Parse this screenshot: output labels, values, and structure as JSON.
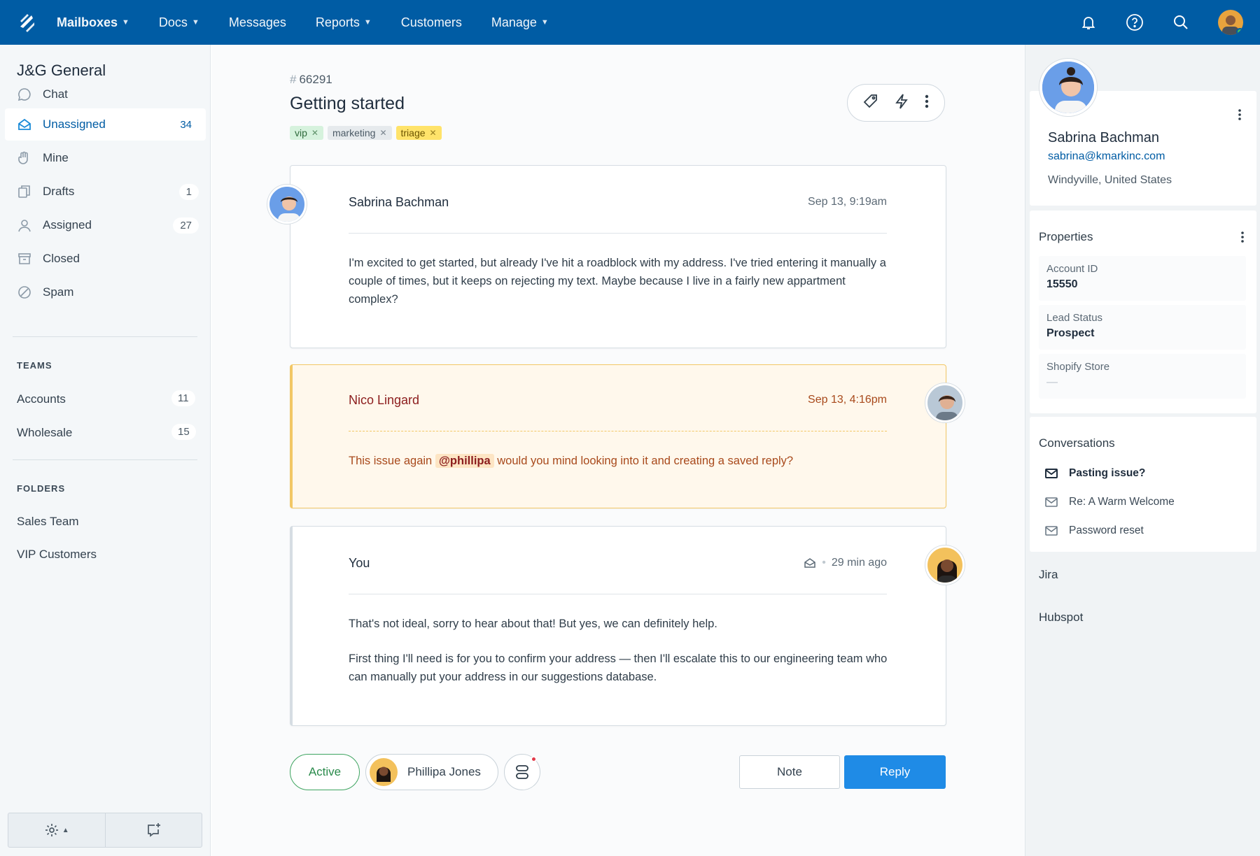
{
  "topnav": {
    "items": [
      {
        "label": "Mailboxes",
        "dropdown": true
      },
      {
        "label": "Docs",
        "dropdown": true
      },
      {
        "label": "Messages",
        "dropdown": false
      },
      {
        "label": "Reports",
        "dropdown": true
      },
      {
        "label": "Customers",
        "dropdown": false
      },
      {
        "label": "Manage",
        "dropdown": true
      }
    ],
    "icons": [
      "bell-icon",
      "help-icon",
      "search-icon",
      "user-avatar"
    ],
    "colors": {
      "bar": "#005ca4"
    }
  },
  "sidebar": {
    "title": "J&G General",
    "items": [
      {
        "label": "Chat",
        "count": "",
        "icon": "chat-icon"
      },
      {
        "label": "Unassigned",
        "count": "34",
        "icon": "inbox-icon",
        "active": true
      },
      {
        "label": "Mine",
        "count": "",
        "icon": "hand-icon"
      },
      {
        "label": "Drafts",
        "count": "1",
        "icon": "drafts-icon"
      },
      {
        "label": "Assigned",
        "count": "27",
        "icon": "person-icon"
      },
      {
        "label": "Closed",
        "count": "",
        "icon": "archive-icon"
      },
      {
        "label": "Spam",
        "count": "",
        "icon": "spam-icon"
      }
    ],
    "teams_heading": "TEAMS",
    "teams": [
      {
        "label": "Accounts",
        "count": "11"
      },
      {
        "label": "Wholesale",
        "count": "15"
      }
    ],
    "folders_heading": "FOLDERS",
    "folders": [
      {
        "label": "Sales Team"
      },
      {
        "label": "VIP Customers"
      }
    ],
    "footer": {
      "settings_icon": "gear-icon",
      "new_icon": "new-chat-icon"
    }
  },
  "conversation": {
    "number": "66291",
    "hash": "#",
    "title": "Getting started",
    "tags": [
      "vip",
      "marketing",
      "triage"
    ],
    "threads": [
      {
        "type": "customer",
        "author": "Sabrina Bachman",
        "time": "Sep 13, 9:19am",
        "body": "I'm excited to get started, but already I've hit a roadblock with my address. I've tried entering it manually a couple of times, but it keeps on rejecting my text. Maybe because I live in a fairly new appartment complex?"
      },
      {
        "type": "note",
        "author": "Nico Lingard",
        "time": "Sep 13, 4:16pm",
        "body_pre": "This issue again",
        "mention": "@phillipa",
        "body_post": "would you mind looking into it and creating a saved reply?"
      },
      {
        "type": "reply",
        "author": "You",
        "time": "29 min ago",
        "sep": "•",
        "body_1": "That's not ideal, sorry to hear about that! But yes, we can definitely help.",
        "body_2": "First thing I'll need is for you to confirm your address — then I'll escalate this to our engineering team who can manually put your address in our suggestions database."
      }
    ],
    "footer": {
      "status": "Active",
      "assignee": "Phillipa Jones",
      "note_label": "Note",
      "reply_label": "Reply"
    }
  },
  "customer": {
    "name": "Sabrina Bachman",
    "email": "sabrina@kmarkinc.com",
    "location": "Windyville, United States",
    "properties_heading": "Properties",
    "properties": [
      {
        "key": "Account ID",
        "value": "15550"
      },
      {
        "key": "Lead Status",
        "value": "Prospect"
      },
      {
        "key": "Shopify Store",
        "value": "—"
      }
    ],
    "conversations_heading": "Conversations",
    "conversations": [
      {
        "label": "Pasting issue?",
        "current": true
      },
      {
        "label": "Re: A Warm Welcome",
        "current": false
      },
      {
        "label": "Password reset",
        "current": false
      }
    ],
    "apps": [
      "Jira",
      "Hubspot"
    ]
  }
}
